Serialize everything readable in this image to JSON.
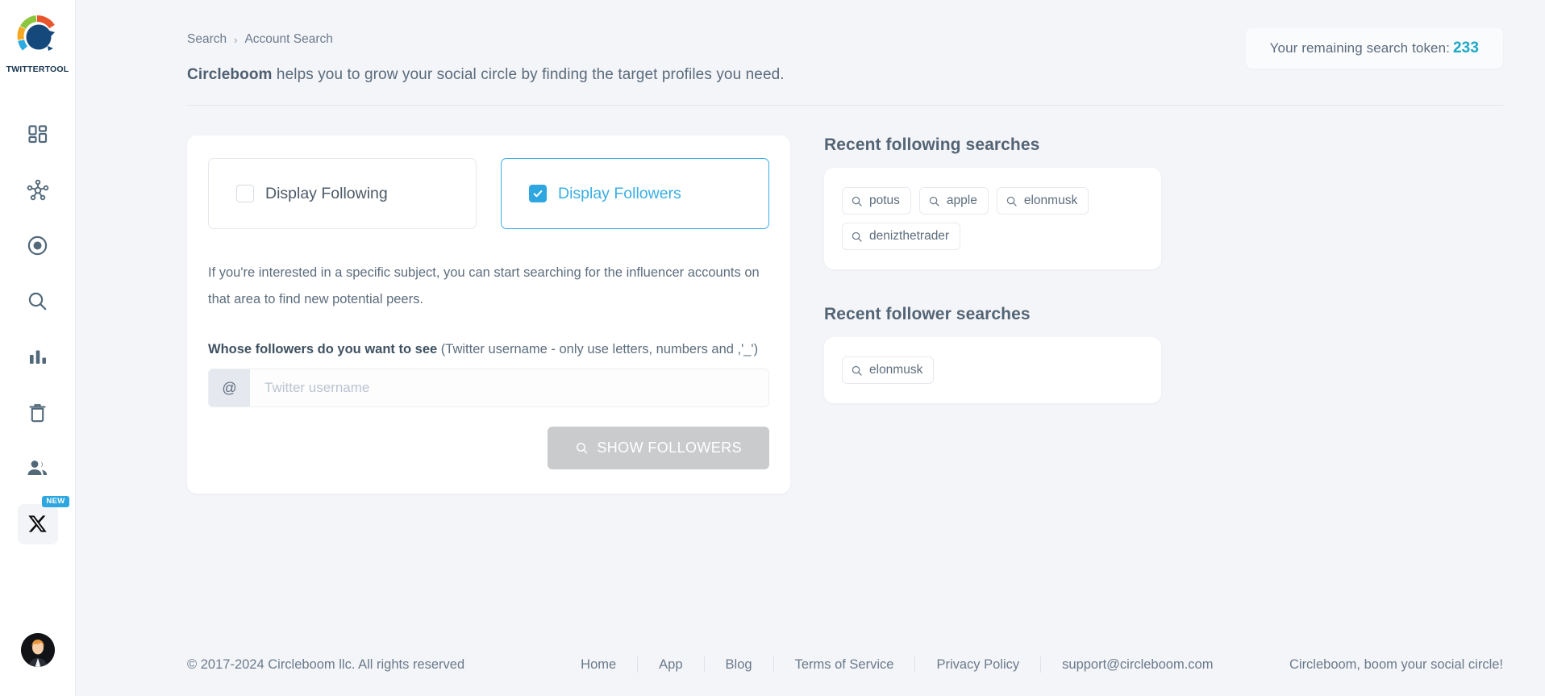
{
  "brand": {
    "name": "TWITTERTOOL",
    "logo_icon": "circleboom-logo-icon"
  },
  "sidebar": {
    "items": [
      {
        "name": "dashboard",
        "icon": "dashboard-grid-icon"
      },
      {
        "name": "network",
        "icon": "network-nodes-icon"
      },
      {
        "name": "target",
        "icon": "target-circle-icon"
      },
      {
        "name": "search",
        "icon": "magnifier-icon"
      },
      {
        "name": "analytics",
        "icon": "bar-chart-icon"
      },
      {
        "name": "cleanup",
        "icon": "trash-bin-icon"
      },
      {
        "name": "audience",
        "icon": "users-icon"
      }
    ],
    "x_button": {
      "icon": "x-twitter-icon",
      "badge": "NEW"
    },
    "avatar": {
      "icon": "user-avatar"
    }
  },
  "header": {
    "breadcrumb": {
      "root": "Search",
      "separator": "›",
      "current": "Account Search"
    },
    "tagline_brand": "Circleboom",
    "tagline_rest": " helps you to grow your social circle by finding the target profiles you need.",
    "token": {
      "label": "Your remaining search token:",
      "value": "233",
      "color": "#1aa8c4"
    }
  },
  "form": {
    "options": [
      {
        "label": "Display Following",
        "checked": false
      },
      {
        "label": "Display Followers",
        "checked": true
      }
    ],
    "blurb": "If you're interested in a specific subject, you can start searching for the influencer accounts on that area to find new potential peers.",
    "field_label_bold": "Whose followers do you want to see",
    "field_label_hint": " (Twitter username - only use letters, numbers and ,'_')",
    "input": {
      "prefix": "@",
      "value": "",
      "placeholder": "Twitter username"
    },
    "submit": {
      "label": "SHOW FOLLOWERS",
      "icon": "magnifier-icon",
      "disabled": true
    }
  },
  "recent_following": {
    "title": "Recent following searches",
    "tags": [
      "potus",
      "apple",
      "elonmusk",
      "denizthetrader"
    ]
  },
  "recent_followers": {
    "title": "Recent follower searches",
    "tags": [
      "elonmusk"
    ]
  },
  "footer": {
    "copyright": "© 2017-2024 Circleboom llc. All rights reserved",
    "links": [
      "Home",
      "App",
      "Blog",
      "Terms of Service",
      "Privacy Policy",
      "support@circleboom.com"
    ],
    "slogan": "Circleboom, boom your social circle!"
  }
}
